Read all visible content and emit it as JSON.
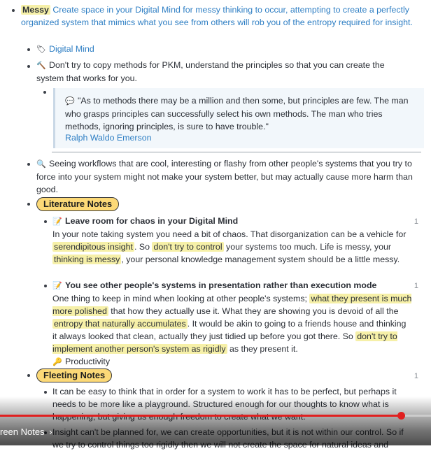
{
  "items": {
    "messy": {
      "label": "Messy",
      "text": "Create space in your Digital Mind for messy thinking to occur, attempting to create a perfectly organized system that mimics what you see from others will rob you of the entropy required for insight."
    },
    "digital_mind": {
      "icon": "🏷",
      "label": "Digital Mind"
    },
    "methods": {
      "icon": "🔨",
      "text": "Don't try to copy methods for PKM, understand the principles so that you can create the system that works for you."
    },
    "quote": {
      "icon": "💬",
      "text": "\"As to methods there may be a million and then some, but principles are few. The man who grasps principles can successfully select his own methods. The man who tries methods, ignoring principles, is sure to have trouble.\"",
      "author": "Ralph Waldo Emerson"
    },
    "workflows": {
      "icon": "🔍",
      "text": "Seeing workflows that are cool, interesting or flashy from other people's systems that you try to force into your system might not make your system better, but may actually cause more harm than good."
    },
    "literature": {
      "label": "Literature Notes"
    },
    "chaos": {
      "icon": "📝",
      "title": "Leave room for chaos in your Digital Mind",
      "count": "1",
      "p1": "In your note taking system you need a bit of chaos. That disorganization can be a vehicle for",
      "h1": "serendipitous insight",
      "p2": ". So",
      "h2": "don't try to control",
      "p3": "your systems too much. Life is messy, your",
      "h3": "thinking is messy",
      "p4": ", your personal knowledge management system should be a little messy."
    },
    "presentation": {
      "icon": "📝",
      "title": "You see other people's systems in presentation rather than execution mode",
      "count": "1",
      "p1": "One thing to keep in mind when looking at other people's systems;",
      "h1": "what they present is much more polished",
      "p2": "that how they actually use it. What they are showing you is devoid of all the",
      "h2": "entropy that naturally accumulates",
      "p3": ". It would be akin to going to a friends house and thinking it always looked that clean, actually they just tidied up before you got there. So",
      "h3": "don't try to implement another person's system as rigidly",
      "p4": "as they present it.",
      "tag_icon": "🔑",
      "tag": "Productivity"
    },
    "fleeting": {
      "label": "Fleeting Notes",
      "count": "1"
    },
    "perfect": {
      "text": "It can be easy to think that in order for a system to work it has to be perfect, but perhaps it needs to be more like a playground. Structured enough for our thoughts to know what is happening, but giving us enough freedom to create what we want."
    },
    "insight": {
      "text": "Insight can't be planned for, we can create opportunities, but it is not within our control. So if we try to control things too rigidly then we will not create the space for natural ideas and"
    }
  },
  "video": {
    "chapter_label": "reen Notes",
    "chapter_arrow": "›",
    "progress_percent": 93
  },
  "colors": {
    "link": "#2f7fc4",
    "highlight": "#f6f0a8",
    "pill": "#fcd977",
    "progress": "#e02020"
  }
}
